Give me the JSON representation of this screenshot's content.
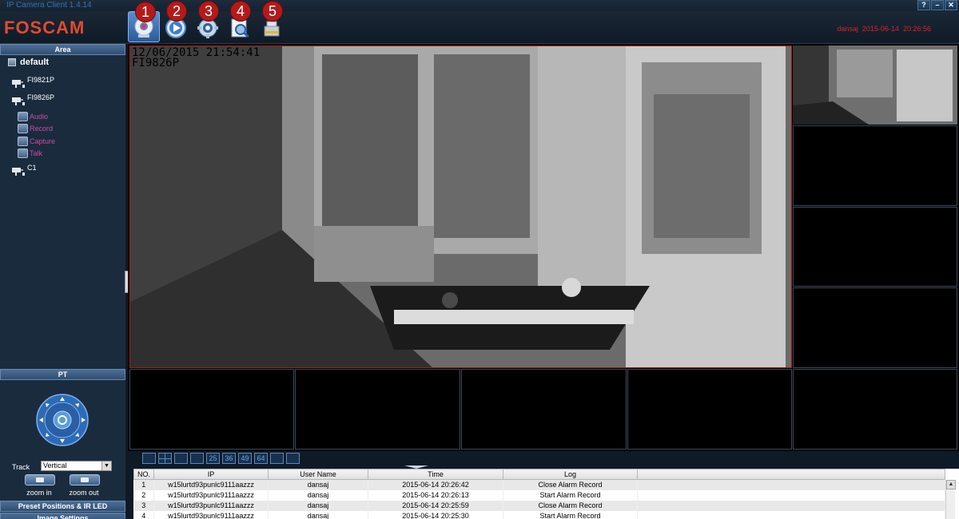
{
  "window": {
    "title": "IP Camera Client 1.4.14",
    "help": "?",
    "minimize": "–",
    "close": "✕"
  },
  "brand": {
    "logo_text": "FOSCAM",
    "logo_color": "#e24a30"
  },
  "toolbar": {
    "items": [
      {
        "name": "live-view",
        "icon": "camera-icon",
        "badge": "1",
        "active": true
      },
      {
        "name": "playback",
        "icon": "play-icon",
        "badge": "2",
        "active": false
      },
      {
        "name": "settings",
        "icon": "gear-icon",
        "badge": "3",
        "active": false
      },
      {
        "name": "search",
        "icon": "magnifier-doc-icon",
        "badge": "4",
        "active": false
      },
      {
        "name": "storage",
        "icon": "disk-icon",
        "badge": "5",
        "active": false
      }
    ]
  },
  "status": {
    "user": "dansaj",
    "date": "2015-06-14",
    "time": "20:26:56",
    "color": "#dd2222"
  },
  "area": {
    "header": "Area",
    "root": "default",
    "cameras": [
      {
        "label": "FI9821P"
      },
      {
        "label": "FI9826P"
      },
      {
        "label": "C1"
      }
    ],
    "sub_items": [
      {
        "label": "Audio",
        "icon": "audio-icon"
      },
      {
        "label": "Record",
        "icon": "record-icon"
      },
      {
        "label": "Capture",
        "icon": "capture-icon"
      },
      {
        "label": "Talk",
        "icon": "talk-icon"
      }
    ]
  },
  "pt": {
    "header": "PT",
    "track_label": "Track",
    "track_value": "Vertical",
    "zoom_in": "zoom in",
    "zoom_out": "zoom out"
  },
  "sections": {
    "preset": "Preset Positions & IR LED",
    "image": "Image Settings"
  },
  "video": {
    "osd_datetime": "12/06/2015 21:54:41",
    "osd_camera": "FI9826P"
  },
  "layouts": [
    "",
    "",
    "",
    "",
    "25",
    "36",
    "49",
    "64",
    "",
    ""
  ],
  "log": {
    "columns": [
      "NO.",
      "IP",
      "User Name",
      "Time",
      "Log"
    ],
    "rows": [
      [
        "1",
        "w15lurtd93punlc9111aazzz",
        "dansaj",
        "2015-06-14 20:26:42",
        "Close Alarm Record"
      ],
      [
        "2",
        "w15lurtd93punlc9111aazzz",
        "dansaj",
        "2015-06-14 20:26:13",
        "Start Alarm Record"
      ],
      [
        "3",
        "w15lurtd93punlc9111aazzz",
        "dansaj",
        "2015-06-14 20:25:59",
        "Close Alarm Record"
      ],
      [
        "4",
        "w15lurtd93punlc9111aazzz",
        "dansaj",
        "2015-06-14 20:25:30",
        "Start Alarm Record"
      ]
    ]
  }
}
